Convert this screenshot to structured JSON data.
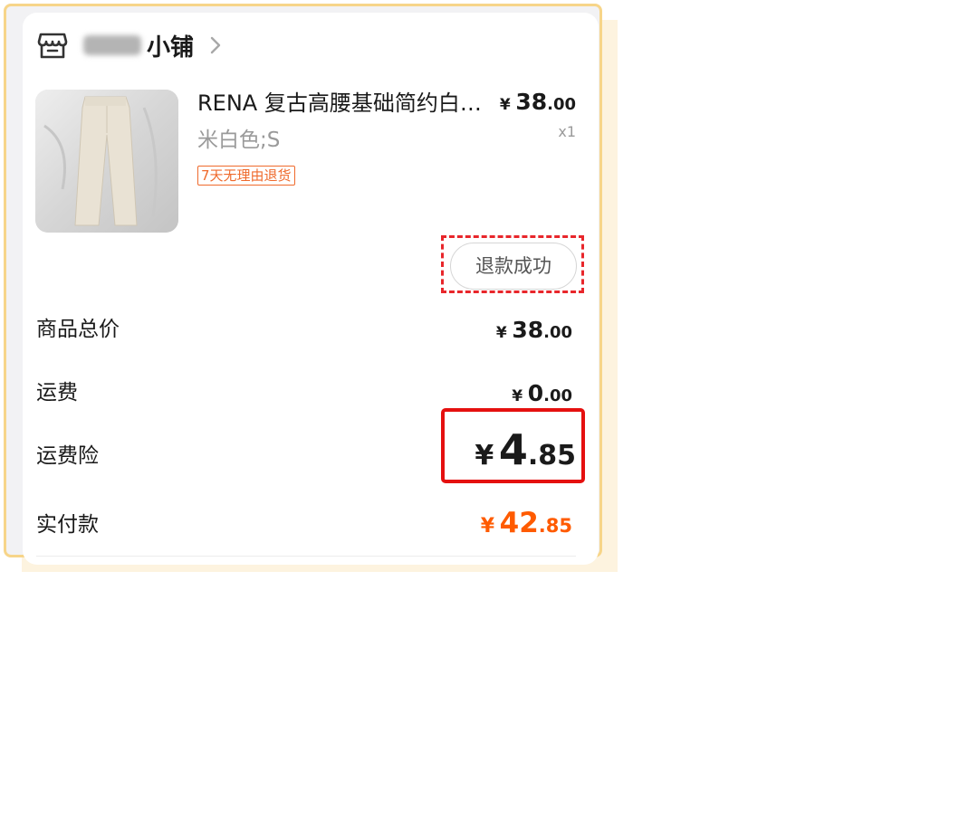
{
  "shop": {
    "name_suffix": "小铺",
    "icons": {
      "store": "store-icon",
      "chevron": "chevron-right-icon"
    }
  },
  "product": {
    "title": "RENA 复古高腰基础简约白…",
    "variant": "米白色;S",
    "return_policy": "7天无理由退货",
    "price": {
      "currency": "¥",
      "integer": "38",
      "decimal": ".00"
    },
    "quantity": "x1",
    "image": "cream-trousers-photo"
  },
  "status_button": "退款成功",
  "summary": [
    {
      "label": "商品总价",
      "currency": "¥",
      "integer": "38",
      "decimal": ".00"
    },
    {
      "label": "运费",
      "currency": "¥",
      "integer": "0",
      "decimal": ".00"
    },
    {
      "label": "运费险",
      "currency": "¥",
      "integer": "4",
      "decimal": ".85"
    },
    {
      "label": "实付款",
      "currency": "¥",
      "integer": "42",
      "decimal": ".85"
    }
  ],
  "colors": {
    "accent_orange": "#ff5b00",
    "annotation_red": "#e5100f",
    "frame_gold": "#f7d589"
  }
}
